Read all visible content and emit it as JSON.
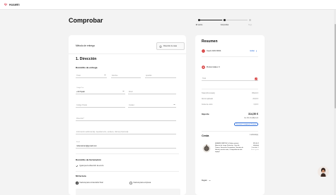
{
  "brand": {
    "name": "HUAWEI"
  },
  "page": {
    "title": "Comprobar"
  },
  "steps": [
    {
      "label": "Mi carrito",
      "active": true
    },
    {
      "label": "Comprobar",
      "active": true
    },
    {
      "label": "Pago",
      "active": false
    }
  ],
  "shipping": {
    "label": "Método de entrega",
    "button": "Dirección de casa"
  },
  "address": {
    "section_title": "1. Dirección",
    "subtitle": "Domicilio de entrega",
    "title_placeholder": "Título",
    "name_placeholder": "Nombre",
    "lastname_placeholder": "Apellido",
    "country_code_label": "Código País",
    "country_code_value": "+34 Spain",
    "phone_placeholder": "Móvil",
    "postal_placeholder": "Código Postal",
    "city_placeholder": "Ciudad",
    "address_placeholder": "Dirección*",
    "extra_placeholder": "Información adicional (Ej. departamento, escalera, oficina) (Opcional)",
    "email_label": "Email",
    "email_value": "rubenarturo@gmail.com"
  },
  "billing": {
    "subtitle": "Domicilio de facturación",
    "same_as_shipping": "Igual que la dirección de envío"
  },
  "invoice": {
    "subtitle": "Mi factura",
    "option_consumer": "Factura para consumidor final",
    "option_company": "Factura para empresa"
  },
  "summary": {
    "title": "Resumen",
    "coupon": "Cupón 30% PASS",
    "edit": "Editar",
    "points": "Puntos totales: 0",
    "total_placeholder": "Total",
    "lines": [
      {
        "label": "Total (IVA incluido)",
        "value": "359,00 €"
      },
      {
        "label": "Ahorro aplicado",
        "value": "-15,00 €"
      },
      {
        "label": "Coste de envío",
        "value": "0,00 €"
      }
    ],
    "import_label": "Importe",
    "import_value": "314,50 €",
    "import_sub": "Sin 314,50 (IVA) 0,00",
    "installments": "Fracciona tu compra por 3 meses"
  },
  "cart": {
    "title": "Cesta",
    "count": "1 artículo(s)",
    "product_desc": "HUAWEI WATCH 5 (Vidrio artista), Batería de Larga Duración, Caja de Titanio, Sensores Ferroplaza, Gestión de Salud y mucho más, Comprobación del equipo",
    "product_price": "359,00 €",
    "product_old_price": "399,00 €",
    "product_qty": "Cantidad: 1",
    "product_extra": "Envío gratis",
    "remove": "Regalo"
  },
  "colors": {
    "accent": "#2a6bd8",
    "coupon_red": "#d32f2f",
    "text": "#111111"
  }
}
